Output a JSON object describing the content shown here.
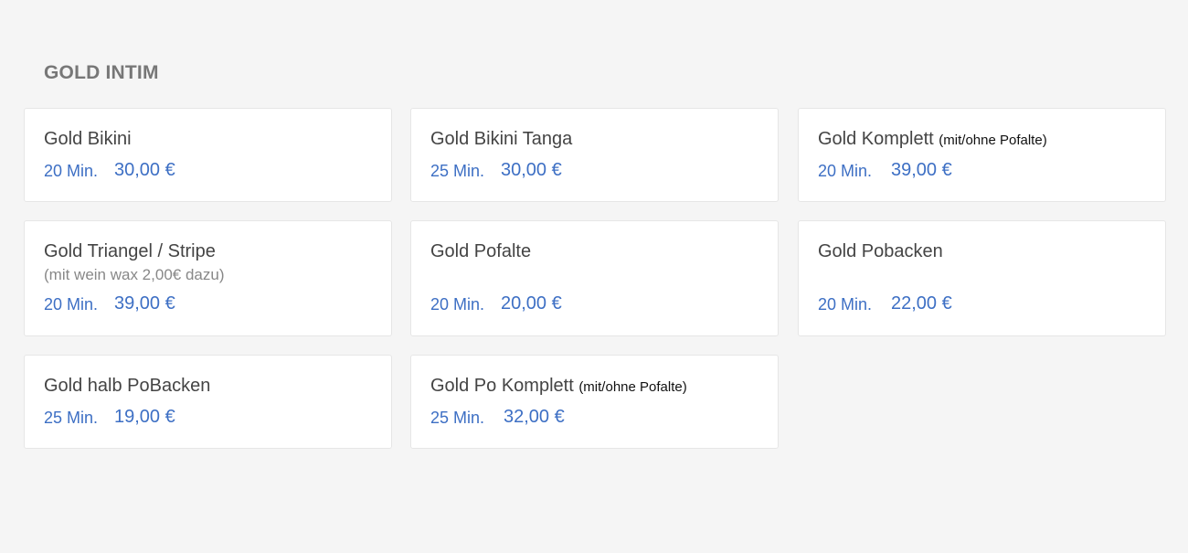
{
  "section": {
    "title": "GOLD INTIM"
  },
  "colors": {
    "background": "#f5f5f5",
    "card": "#ffffff",
    "accent": "#3d6fc4",
    "title": "#777777"
  },
  "services": [
    {
      "name": "Gold Bikini",
      "suffix": "",
      "note": "",
      "duration": "20 Min.",
      "price": "30,00 €"
    },
    {
      "name": "Gold Bikini Tanga",
      "suffix": "",
      "note": "",
      "duration": "25 Min.",
      "price": "30,00 €"
    },
    {
      "name": "Gold Komplett",
      "suffix": "(mit/ohne Pofalte)",
      "note": "",
      "duration": "20 Min.",
      "price": "39,00 €"
    },
    {
      "name": "Gold Triangel / Stripe",
      "suffix": "",
      "note": "(mit wein wax 2,00€ dazu)",
      "duration": "20 Min.",
      "price": "39,00 €"
    },
    {
      "name": "Gold Pofalte",
      "suffix": "",
      "note": "",
      "duration": "20 Min.",
      "price": "20,00 €"
    },
    {
      "name": "Gold Pobacken",
      "suffix": "",
      "note": "",
      "duration": "20 Min.",
      "price": "22,00 €"
    },
    {
      "name": "Gold halb PoBacken",
      "suffix": "",
      "note": "",
      "duration": "25 Min.",
      "price": "19,00 €"
    },
    {
      "name": "Gold Po Komplett",
      "suffix": "(mit/ohne Pofalte)",
      "note": "",
      "duration": "25 Min.",
      "price": "32,00 €"
    }
  ]
}
